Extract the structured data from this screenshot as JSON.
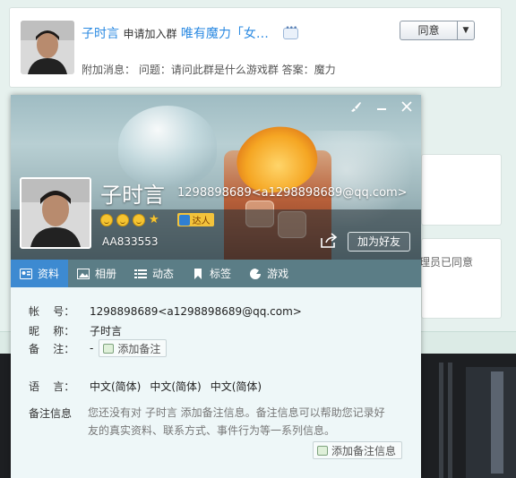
{
  "notice": {
    "name": "子时言",
    "action": "申请加入群",
    "group": "唯有魔力「女…",
    "extra": "附加消息： 问题：请问此群是什么游戏群 答案：魔力",
    "agree_label": "同意"
  },
  "background": {
    "card_text": "理员已同意"
  },
  "profile": {
    "name": "子时言",
    "qq": "1298898689<a1298898689@qq.com>",
    "badge": "达人",
    "account": "AA833553",
    "add_friend": "加为好友"
  },
  "tabs": [
    {
      "label": "资料",
      "icon": "profile-card-icon"
    },
    {
      "label": "相册",
      "icon": "photo-album-icon"
    },
    {
      "label": "动态",
      "icon": "feed-list-icon"
    },
    {
      "label": "标签",
      "icon": "bookmark-icon"
    },
    {
      "label": "游戏",
      "icon": "game-icon"
    }
  ],
  "info": {
    "account_label": "帐    号：",
    "account_value": "1298898689<a1298898689@qq.com>",
    "nick_label": "昵    称：",
    "nick_value": "子时言",
    "remark_label": "备    注：",
    "remark_value": "-",
    "add_remark": "添加备注",
    "lang_label": "语    言：",
    "lang_values": [
      "中文(简体)",
      "中文(简体)",
      "中文(简体)"
    ],
    "note_label": "备注信息",
    "note_desc": "您还没有对 子时言 添加备注信息。备注信息可以帮助您记录好友的真实资料、联系方式、事件行为等一系列信息。",
    "add_note": "添加备注信息"
  },
  "colors": {
    "link": "#2b8ae2",
    "tab_active": "#3d8ad1",
    "tab_bar": "#5b7d86"
  }
}
